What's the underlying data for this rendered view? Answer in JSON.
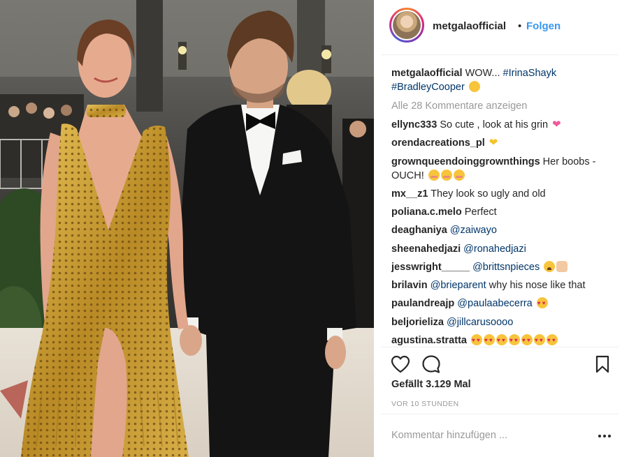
{
  "post": {
    "username": "metgalaofficial",
    "follow_separator": "•",
    "follow_label": "Folgen",
    "caption_text": "WOW...",
    "caption_tags": [
      "#IrinaShayk",
      "#BradleyCooper"
    ],
    "caption_emoji": "wink-emoji",
    "show_all_comments": "Alle 28 Kommentare anzeigen"
  },
  "comments": [
    {
      "user": "ellync333",
      "text": "So cute , look at his grin",
      "emoji": [
        "sparkling-heart"
      ]
    },
    {
      "user": "orendacreations_pl",
      "text": "",
      "emoji": [
        "yellow-heart"
      ]
    },
    {
      "user": "grownqueendoinggrownthings",
      "text": "Her boobs - OUCH!",
      "emoji": [
        "flushed",
        "flushed",
        "flushed"
      ]
    },
    {
      "user": "mx__z1",
      "text": "They look so ugly and old",
      "emoji": []
    },
    {
      "user": "poliana.c.melo",
      "text": "Perfect",
      "emoji": []
    },
    {
      "user": "deaghaniya",
      "mention": "@zaiwayo",
      "emoji": []
    },
    {
      "user": "sheenahedjazi",
      "mention": "@ronahedjazi",
      "emoji": []
    },
    {
      "user": "jesswright_____",
      "mention": "@brittsnpieces",
      "emoji": [
        "weary",
        "raised-hands"
      ]
    },
    {
      "user": "brilavin",
      "mention": "@brieparent",
      "text": "why his nose like that",
      "emoji": []
    },
    {
      "user": "paulandreajp",
      "mention": "@paulaabecerra",
      "emoji": [
        "heart-eyes"
      ]
    },
    {
      "user": "beljorieliza",
      "mention": "@jillcarusoooo",
      "emoji": []
    },
    {
      "user": "agustina.stratta",
      "text": "",
      "emoji": [
        "heart-eyes",
        "heart-eyes",
        "heart-eyes",
        "heart-eyes",
        "heart-eyes",
        "heart-eyes",
        "heart-eyes"
      ]
    }
  ],
  "actions": {
    "like_icon": "heart-outline-icon",
    "comment_icon": "comment-bubble-icon",
    "save_icon": "bookmark-icon",
    "likes_text": "Gefällt 3.129 Mal",
    "timestamp": "VOR 10 STUNDEN"
  },
  "comment_box": {
    "placeholder": "Kommentar hinzufügen ...",
    "more_icon": "ellipsis-icon"
  },
  "colors": {
    "link_blue": "#3897f0",
    "mention_blue": "#003569",
    "muted_gray": "#999999",
    "text_dark": "#262626"
  }
}
